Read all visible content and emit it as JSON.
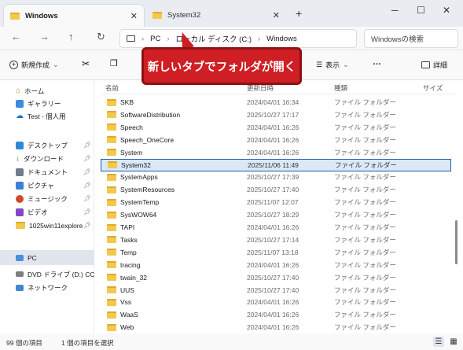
{
  "tabs": [
    {
      "label": "Windows",
      "active": true
    },
    {
      "label": "System32",
      "active": false
    }
  ],
  "window_controls": {
    "minimize": "─",
    "maximize": "☐",
    "close": "✕"
  },
  "address_bar": {
    "segments": [
      "PC",
      "ローカル ディスク (C:)",
      "Windows"
    ],
    "separator": "›"
  },
  "search": {
    "placeholder": "Windowsの検索"
  },
  "toolbar": {
    "new_label": "新規作成",
    "view_label": "表示",
    "more_label": "…",
    "details_label": "詳細"
  },
  "callout": {
    "text": "新しいタブでフォルダが開く"
  },
  "navigation": [
    {
      "label": "ホーム",
      "icon": "home-icon",
      "pinned": false
    },
    {
      "label": "ギャラリー",
      "icon": "gallery-icon",
      "pinned": false
    },
    {
      "label": "Test - 個人用",
      "icon": "cloud-icon",
      "pinned": false
    },
    {
      "label": "デスクトップ",
      "icon": "desktop-icon",
      "pinned": true
    },
    {
      "label": "ダウンロード",
      "icon": "download-icon",
      "pinned": true
    },
    {
      "label": "ドキュメント",
      "icon": "documents-icon",
      "pinned": true
    },
    {
      "label": "ピクチャ",
      "icon": "pictures-icon",
      "pinned": true
    },
    {
      "label": "ミュージック",
      "icon": "music-icon",
      "pinned": true
    },
    {
      "label": "ビデオ",
      "icon": "videos-icon",
      "pinned": true
    },
    {
      "label": "1025win11explore",
      "icon": "folder-icon",
      "pinned": true
    },
    {
      "label": "PC",
      "icon": "pc-icon",
      "pinned": false,
      "selected": true
    },
    {
      "label": "DVD ドライブ (D:) CCCC",
      "icon": "dvd-icon",
      "pinned": false
    },
    {
      "label": "ネットワーク",
      "icon": "network-icon",
      "pinned": false
    }
  ],
  "columns": {
    "name": "名前",
    "date": "更新日時",
    "type": "種類",
    "size": "サイズ"
  },
  "files": [
    {
      "name": "SKB",
      "date": "2024/04/01 16:34",
      "type": "ファイル フォルダー"
    },
    {
      "name": "SoftwareDistribution",
      "date": "2025/10/27 17:17",
      "type": "ファイル フォルダー"
    },
    {
      "name": "Speech",
      "date": "2024/04/01 16:26",
      "type": "ファイル フォルダー"
    },
    {
      "name": "Speech_OneCore",
      "date": "2024/04/01 16:26",
      "type": "ファイル フォルダー"
    },
    {
      "name": "System",
      "date": "2024/04/01 16:26",
      "type": "ファイル フォルダー"
    },
    {
      "name": "System32",
      "date": "2025/11/06 11:49",
      "type": "ファイル フォルダー",
      "selected": true
    },
    {
      "name": "SystemApps",
      "date": "2025/10/27 17:39",
      "type": "ファイル フォルダー"
    },
    {
      "name": "SystemResources",
      "date": "2025/10/27 17:40",
      "type": "ファイル フォルダー"
    },
    {
      "name": "SystemTemp",
      "date": "2025/11/07 12:07",
      "type": "ファイル フォルダー"
    },
    {
      "name": "SysWOW64",
      "date": "2025/10/27 18:29",
      "type": "ファイル フォルダー"
    },
    {
      "name": "TAPI",
      "date": "2024/04/01 16:26",
      "type": "ファイル フォルダー"
    },
    {
      "name": "Tasks",
      "date": "2025/10/27 17:14",
      "type": "ファイル フォルダー"
    },
    {
      "name": "Temp",
      "date": "2025/11/07 13:18",
      "type": "ファイル フォルダー"
    },
    {
      "name": "tracing",
      "date": "2024/04/01 16:26",
      "type": "ファイル フォルダー"
    },
    {
      "name": "twain_32",
      "date": "2025/10/27 17:40",
      "type": "ファイル フォルダー"
    },
    {
      "name": "UUS",
      "date": "2025/10/27 17:40",
      "type": "ファイル フォルダー"
    },
    {
      "name": "Vss",
      "date": "2024/04/01 16:26",
      "type": "ファイル フォルダー"
    },
    {
      "name": "WaaS",
      "date": "2024/04/01 16:26",
      "type": "ファイル フォルダー"
    },
    {
      "name": "Web",
      "date": "2024/04/01 16:26",
      "type": "ファイル フォルダー"
    }
  ],
  "status": {
    "item_count": "99 個の項目",
    "selection": "1 個の項目を選択"
  },
  "colors": {
    "callout": "#cf1f24",
    "selection_border": "#1e5ba8",
    "folder": "#f2c94c"
  }
}
